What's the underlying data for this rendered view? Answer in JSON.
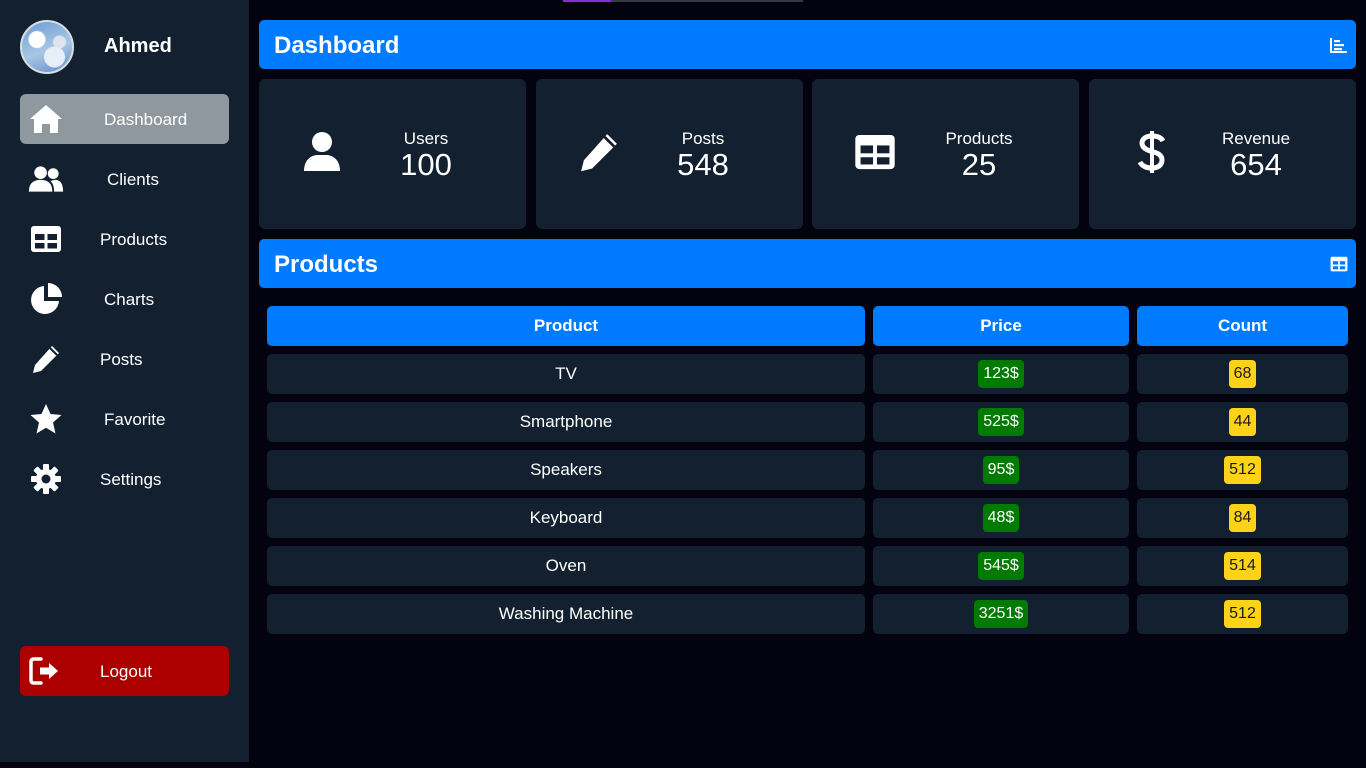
{
  "profile": {
    "name": "Ahmed"
  },
  "sidebar": {
    "items": [
      {
        "label": "Dashboard",
        "icon": "home-icon",
        "active": true
      },
      {
        "label": "Clients",
        "icon": "users-icon"
      },
      {
        "label": "Products",
        "icon": "table-icon"
      },
      {
        "label": "Charts",
        "icon": "pie-chart-icon"
      },
      {
        "label": "Posts",
        "icon": "pencil-icon"
      },
      {
        "label": "Favorite",
        "icon": "star-icon"
      },
      {
        "label": "Settings",
        "icon": "gear-icon"
      }
    ],
    "logout": {
      "label": "Logout",
      "icon": "logout-icon"
    }
  },
  "dashboard": {
    "title": "Dashboard",
    "icon": "bar-chart-icon",
    "stats": [
      {
        "label": "Users",
        "value": "100",
        "icon": "user-icon"
      },
      {
        "label": "Posts",
        "value": "548",
        "icon": "pencil-icon"
      },
      {
        "label": "Products",
        "value": "25",
        "icon": "table-icon"
      },
      {
        "label": "Revenue",
        "value": "654",
        "icon": "dollar-icon"
      }
    ]
  },
  "products": {
    "title": "Products",
    "icon": "table-icon",
    "columns": [
      "Product",
      "Price",
      "Count"
    ],
    "rows": [
      {
        "product": "TV",
        "price": "123$",
        "count": "68"
      },
      {
        "product": "Smartphone",
        "price": "525$",
        "count": "44"
      },
      {
        "product": "Speakers",
        "price": "95$",
        "count": "512"
      },
      {
        "product": "Keyboard",
        "price": "48$",
        "count": "84"
      },
      {
        "product": "Oven",
        "price": "545$",
        "count": "514"
      },
      {
        "product": "Washing Machine",
        "price": "3251$",
        "count": "512"
      }
    ]
  },
  "colors": {
    "accent": "#007bff",
    "sidebar_bg": "#122030",
    "page_bg": "#03030f",
    "active_item": "#8f979f",
    "logout": "#ac0000",
    "price_badge": "#007a00",
    "count_badge": "#ffd21a"
  }
}
